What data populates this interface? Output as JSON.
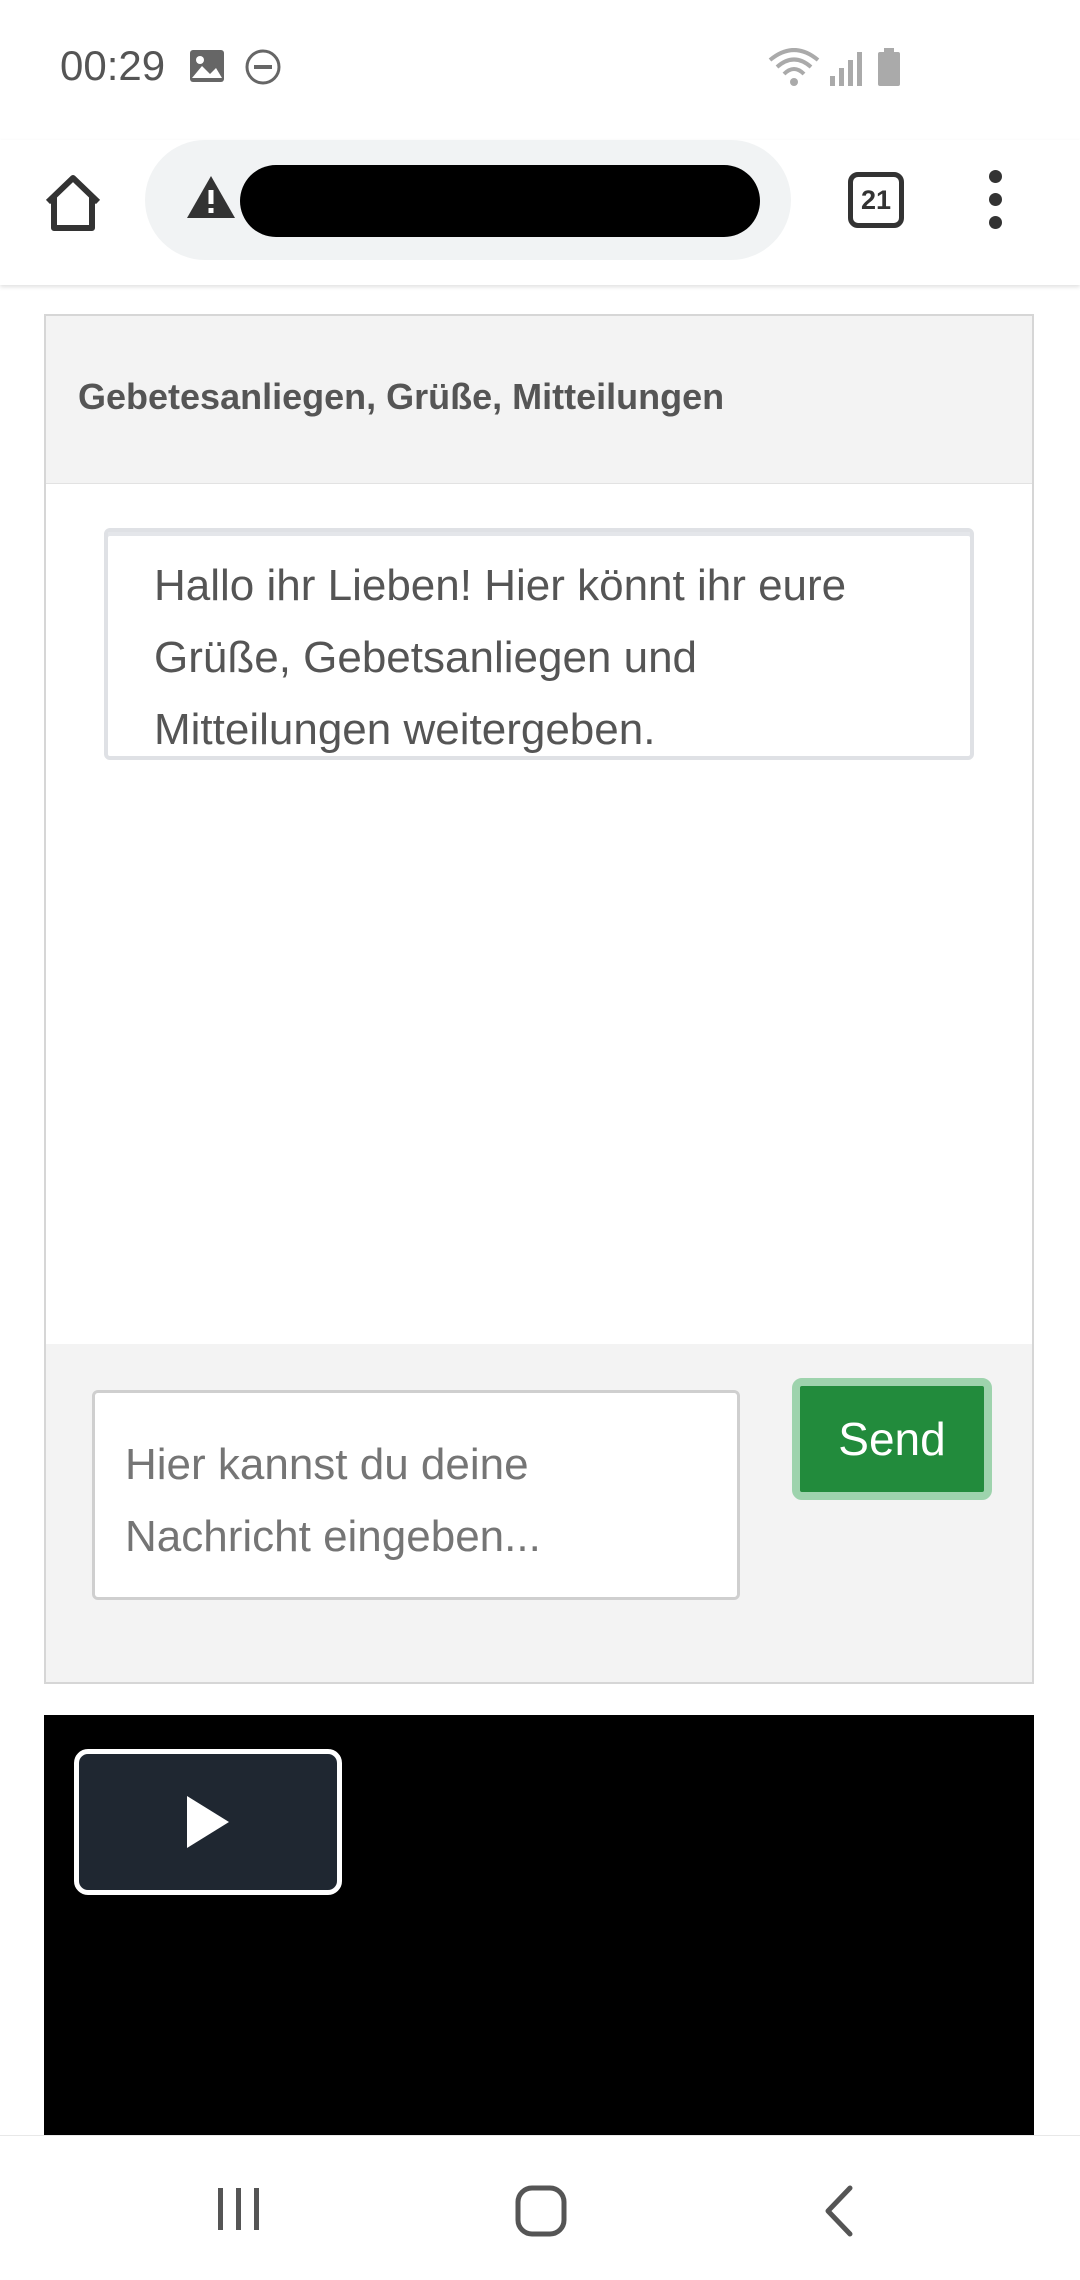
{
  "status_bar": {
    "time": "00:29",
    "icons": [
      "image-icon",
      "dnd-icon",
      "wifi-icon",
      "signal-icon",
      "battery-icon"
    ]
  },
  "browser": {
    "tab_count": "21",
    "url": "",
    "icons": [
      "home-icon",
      "warning-icon",
      "tabs-icon",
      "more-vert-icon"
    ]
  },
  "chat": {
    "title": "Gebetesanliegen, Grüße, Mitteilungen",
    "messages": [
      {
        "text": "Hallo ihr Lieben! Hier könnt ihr eure Grüße, Gebetsanliegen und Mitteilungen weitergeben."
      }
    ],
    "input_placeholder": "Hier kannst du deine Nachricht eingeben...",
    "send_label": "Send",
    "send_color": "#228b3c"
  },
  "video": {
    "play_icon": "play-icon"
  },
  "nav_bar": {
    "icons": [
      "recent-apps-icon",
      "home-nav-icon",
      "back-icon"
    ]
  }
}
